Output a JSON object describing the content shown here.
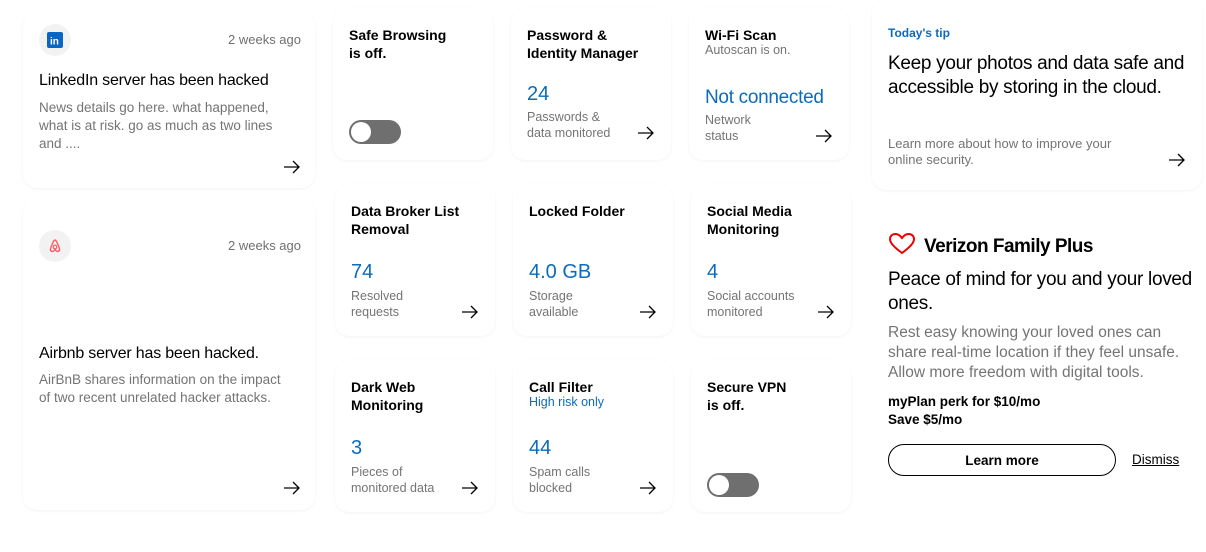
{
  "news": [
    {
      "logo_icon": "linkedin-icon",
      "time": "2 weeks ago",
      "title": "LinkedIn server has been hacked",
      "body": "News details go here. what happened, what is at risk. go as much as two lines and ...."
    },
    {
      "logo_icon": "airbnb-icon",
      "time": "2 weeks ago",
      "title": "Airbnb server has been hacked.",
      "body": "AirBnB shares information on the impact of two recent unrelated hacker attacks."
    }
  ],
  "tiles": {
    "safe_browsing": {
      "title": "Safe Browsing is off.",
      "toggle_on": false
    },
    "password_manager": {
      "title": "Password & Identity Manager",
      "value": "24",
      "label": "Passwords & data monitored"
    },
    "wifi_scan": {
      "title": "Wi-Fi Scan",
      "subtitle": "Autoscan is on.",
      "value": "Not connected",
      "label": "Network status"
    },
    "data_broker": {
      "title": "Data Broker List Removal",
      "value": "74",
      "label": "Resolved requests"
    },
    "locked_folder": {
      "title": "Locked Folder",
      "value": "4.0 GB",
      "label": "Storage available"
    },
    "social_media": {
      "title": "Social Media Monitoring",
      "value": "4",
      "label": "Social accounts monitored"
    },
    "dark_web": {
      "title": "Dark Web Monitoring",
      "value": "3",
      "label": "Pieces of monitored data"
    },
    "call_filter": {
      "title": "Call Filter",
      "subtitle": "High risk only",
      "value": "44",
      "label": "Spam calls blocked"
    },
    "secure_vpn": {
      "title": "Secure VPN is off.",
      "toggle_on": false
    }
  },
  "tip": {
    "heading": "Today's tip",
    "text": "Keep your photos and data safe and accessible by storing in the cloud.",
    "sub": "Learn more about how to improve your online security."
  },
  "promo": {
    "brand": "Verizon Family Plus",
    "brand_icon": "heart-icon",
    "headline": "Peace of mind for you and your loved ones.",
    "body": "Rest easy knowing your loved ones can share real-time location if they feel unsafe. Allow more freedom with digital tools.",
    "perk_line1": "myPlan perk for $10/mo",
    "perk_line2": "Save $5/mo",
    "learn_more": "Learn more",
    "dismiss": "Dismiss"
  },
  "colors": {
    "accent_blue": "#0a6bbf",
    "verizon_red": "#ee0000",
    "toggle_off": "#6f6f6f",
    "muted_text": "#747474"
  }
}
